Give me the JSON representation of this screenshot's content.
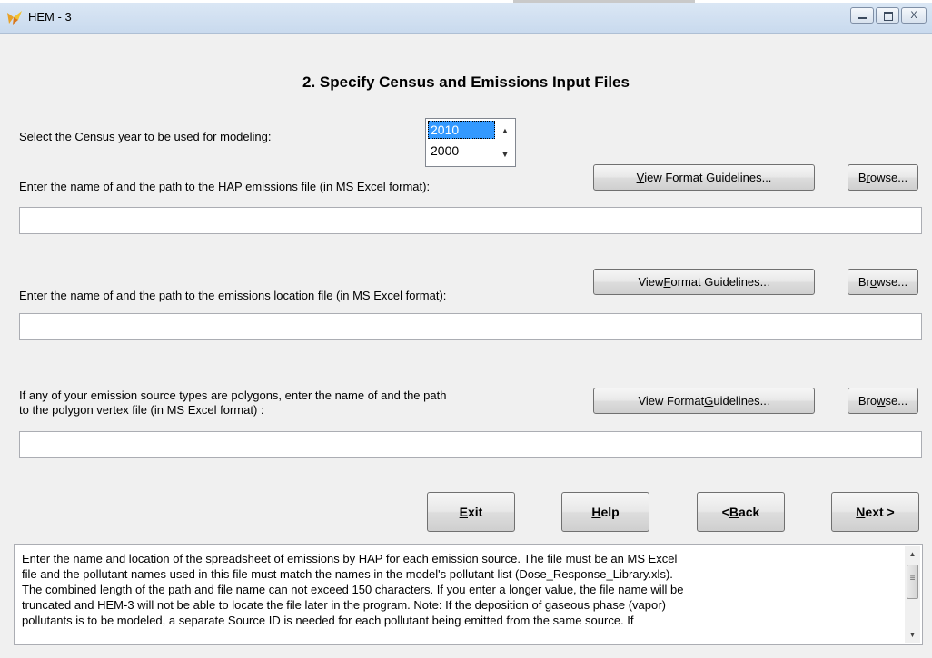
{
  "window": {
    "title": "HEM - 3",
    "buttons": {
      "minimize_icon": "minimize-icon",
      "maximize_icon": "maximize-icon",
      "close_glyph": "X"
    }
  },
  "main": {
    "heading": "2. Specify Census and Emissions Input Files",
    "census": {
      "label": "Select the Census year to be used for modeling:",
      "years": [
        "2010",
        "2000"
      ],
      "selected": "2010"
    },
    "hap_emissions": {
      "label": "Enter the name of and the path to the HAP emissions file (in MS Excel format):",
      "guidelines_pre": "",
      "guidelines_key": "V",
      "guidelines_post": "iew Format Guidelines...",
      "browse_pre": "B",
      "browse_key": "r",
      "browse_post": "owse...",
      "value": ""
    },
    "emissions_location": {
      "label": "Enter the name of and the path to the emissions location file (in MS Excel format):",
      "guidelines_pre": "View ",
      "guidelines_key": "F",
      "guidelines_post": "ormat Guidelines...",
      "browse_pre": "Br",
      "browse_key": "o",
      "browse_post": "wse...",
      "value": ""
    },
    "polygon_vertex": {
      "label_line1": "If any of your emission source types are polygons, enter the name of and the path",
      "label_line2": "to the polygon vertex file (in MS Excel format) :",
      "guidelines_pre": "View Format ",
      "guidelines_key": "G",
      "guidelines_post": "uidelines...",
      "browse_pre": "Bro",
      "browse_key": "w",
      "browse_post": "se...",
      "value": ""
    }
  },
  "nav": {
    "exit_key": "E",
    "exit_rest": "xit",
    "help_key": "H",
    "help_rest": "elp",
    "back_pre": "< ",
    "back_key": "B",
    "back_rest": "ack",
    "next_key": "N",
    "next_rest": "ext >"
  },
  "description": {
    "text": "Enter the name and location of the spreadsheet of emissions by HAP for each emission source. The file must be an MS Excel\nfile and the pollutant names used in this file must match the names in the model's pollutant list (Dose_Response_Library.xls).\nThe combined length of the path and file name can not exceed 150 characters. If you enter a longer value, the file name will be\ntruncated and HEM-3 will not be able to locate the file later in the program. Note: If the deposition of gaseous phase (vapor)\npollutants is to be modeled,  a separate Source ID is needed for each pollutant being emitted from the same  source. If"
  },
  "colors": {
    "selection": "#3399ff",
    "titlebar": "#c9daee",
    "dialog_bg": "#f0f0f0"
  }
}
